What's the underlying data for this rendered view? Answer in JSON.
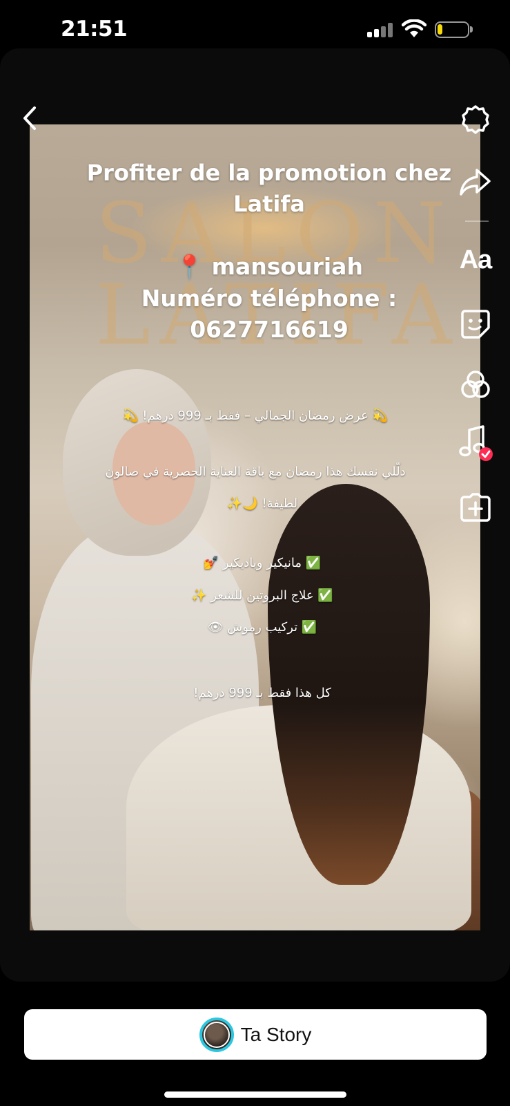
{
  "status_bar": {
    "time": "21:51",
    "signal_bars_active": 2,
    "battery_level": 0.18,
    "battery_color": "#f5d90a"
  },
  "story": {
    "background_sign_lines": [
      "SALON",
      "LATIFA"
    ],
    "title": "Profiter de la promotion chez Latifa",
    "location_icon": "📍",
    "location": "mansouriah",
    "phone_label": "Numéro téléphone :",
    "phone_number": "0627716619",
    "arabic_lines": [
      "💫 عرض رمضان الجمالي – فقط بـ 999 درهم! 💫",
      "دلّلي نفسك هذا رمضان مع باقة العناية الحصرية في صالون",
      "لطيفة! 🌙✨",
      "✅ مانيكير وباديكير 💅",
      "✅ علاج البروتين للشعر ✨",
      "✅ تركيب رموش 👁",
      "كل هذا فقط بـ 999 درهم!"
    ]
  },
  "tools": {
    "text_tool_label": "Aa",
    "icons": [
      "settings-icon",
      "share-icon",
      "text-icon",
      "sticker-icon",
      "effects-icon",
      "music-icon",
      "add-icon"
    ],
    "music_badge_color": "#fe2c55"
  },
  "bottom": {
    "story_button_label": "Ta Story",
    "avatar_ring_color": "#2bc7e0"
  }
}
